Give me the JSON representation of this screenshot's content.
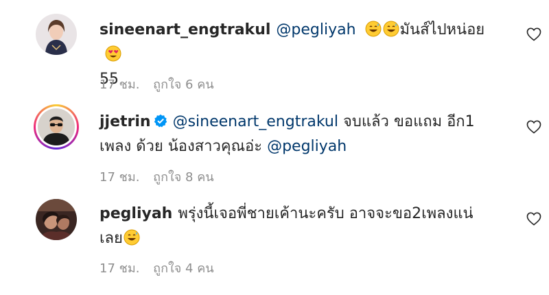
{
  "comments": [
    {
      "username": "sineenart_engtrakul",
      "mention": "@pegliyah",
      "text_after": "มันส์ไปหน่อย",
      "line2": "55",
      "time": "17 ชม.",
      "likes": "ถูกใจ 6 คน",
      "avatar_icon": "woman-portrait-avatar",
      "emojis": [
        "grinning-sweat-emoji",
        "grinning-sweat-emoji",
        "heart-eyes-emoji"
      ]
    },
    {
      "username": "jjetrin",
      "verified": true,
      "mention": "@sineenart_engtrakul",
      "text_after": "จบแล้ว ขอแถม อีก1",
      "line2_text": "เพลง ด้วย น้องสาวคุณอ่ะ",
      "line2_mention": "@pegliyah",
      "time": "17 ชม.",
      "likes": "ถูกใจ 8 คน",
      "avatar_icon": "man-sunglasses-avatar",
      "story_ring": true
    },
    {
      "username": "pegliyah",
      "text": "พรุ่งนี้เจอพี่ชายเค้านะครับ อาจจะขอ2เพลงแน่",
      "line2": "เลย",
      "time": "17 ชม.",
      "likes": "ถูกใจ 4 คน",
      "avatar_icon": "woman-dark-photo-avatar",
      "emojis": [
        "grinning-sweat-emoji"
      ]
    }
  ],
  "colors": {
    "text": "#262626",
    "mention": "#00376b",
    "meta": "#8e8e8e",
    "verified": "#0095f6"
  }
}
